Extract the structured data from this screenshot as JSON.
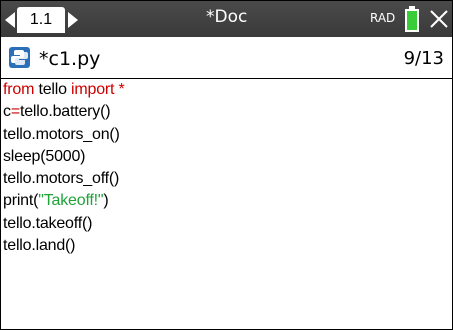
{
  "titlebar": {
    "tab_label": "1.1",
    "doc_title": "*Doc",
    "angle_mode": "RAD"
  },
  "file": {
    "name": "*c1.py",
    "position": "9/13"
  },
  "code": {
    "l1_kw1": "from",
    "l1_mod": " tello ",
    "l1_kw2": "import",
    "l1_star": " *",
    "l2_var": "c",
    "l2_eq": "=",
    "l2_rest": "tello.battery()",
    "l3": "tello.motors_on()",
    "l4": "sleep(5000)",
    "l5": "tello.motors_off()",
    "l6_a": "print(",
    "l6_str": "\"Takeoff!\"",
    "l6_b": ")",
    "l7": "tello.takeoff()",
    "l8": "tello.land()"
  },
  "colors": {
    "keyword": "#cc0000",
    "string": "#1fa33a",
    "titlebar": "#3f3f3f",
    "battery": "#3acd3a"
  }
}
